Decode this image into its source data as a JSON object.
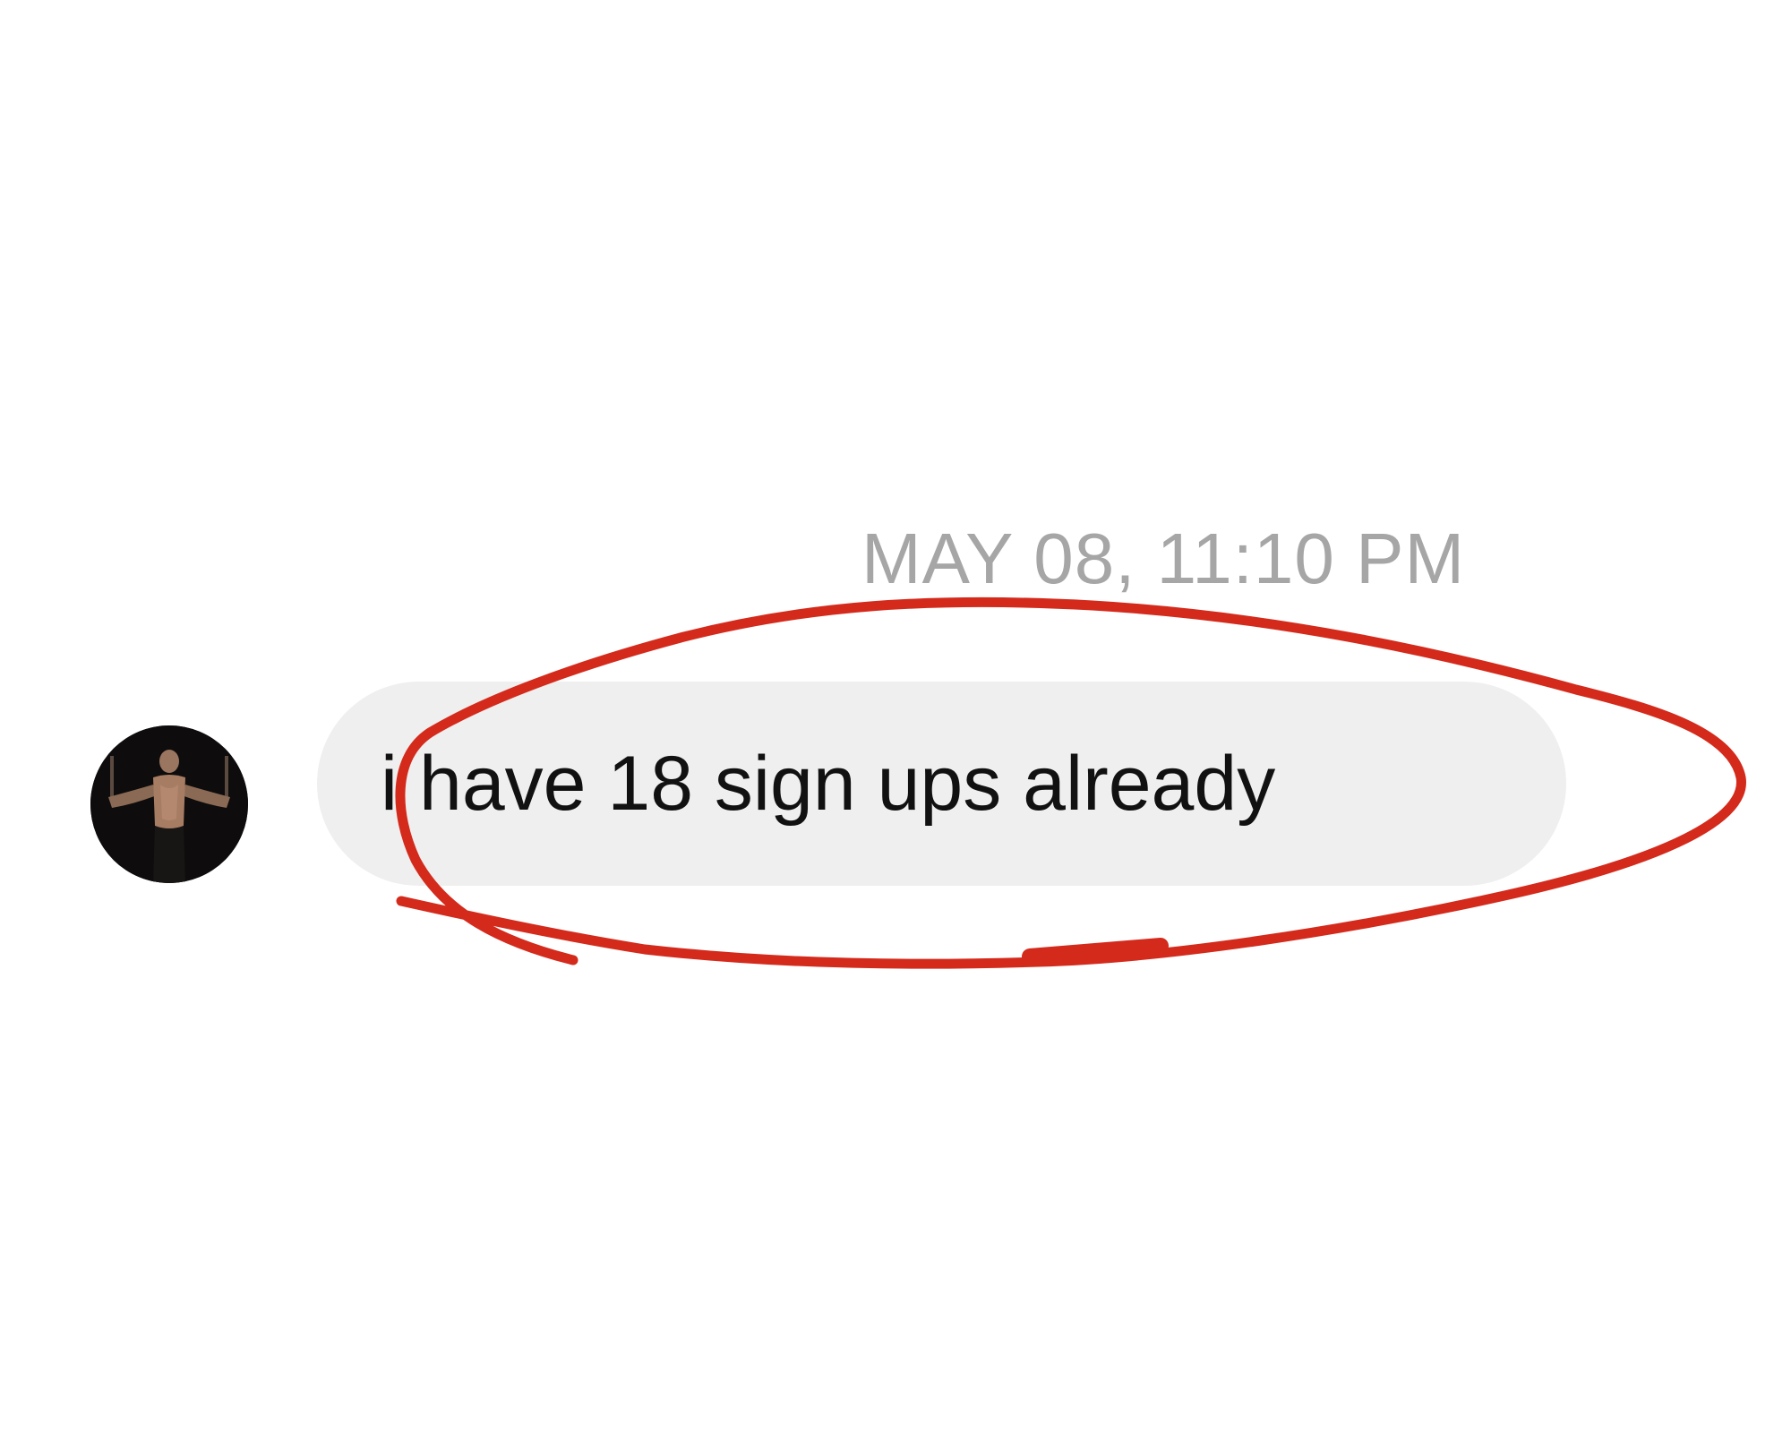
{
  "conversation": {
    "timestamp": "MAY 08, 11:10 PM",
    "messages": [
      {
        "sender_avatar": "person-photo",
        "text": "i have 18 sign ups already"
      }
    ]
  },
  "annotation": {
    "shape": "hand-drawn-ellipse",
    "color": "#d42a1c"
  },
  "colors": {
    "timestamp": "#a6a6a6",
    "bubble": "#efefef",
    "message_text": "#111111",
    "background": "#ffffff"
  }
}
